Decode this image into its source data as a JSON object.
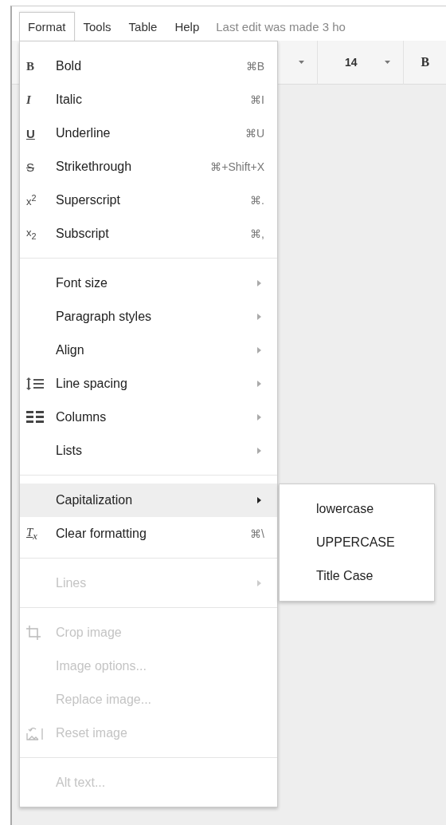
{
  "menu_bar": {
    "items": [
      {
        "label": "Format",
        "selected": true
      },
      {
        "label": "Tools",
        "selected": false
      },
      {
        "label": "Table",
        "selected": false
      },
      {
        "label": "Help",
        "selected": false
      }
    ],
    "status": "Last edit was made 3 ho"
  },
  "toolbar": {
    "items": [
      {
        "kind": "caret"
      },
      {
        "kind": "text",
        "label": "14"
      },
      {
        "kind": "caret"
      },
      {
        "kind": "bold",
        "label": "B"
      }
    ]
  },
  "format_menu": {
    "sections": [
      [
        {
          "label": "Bold",
          "shortcut": "⌘B",
          "icon": {
            "kind": "bold",
            "glyph": "B"
          },
          "has_submenu": false,
          "disabled": false,
          "selected": false
        },
        {
          "label": "Italic",
          "shortcut": "⌘I",
          "icon": {
            "kind": "italic",
            "glyph": "I"
          },
          "has_submenu": false,
          "disabled": false,
          "selected": false
        },
        {
          "label": "Underline",
          "shortcut": "⌘U",
          "icon": {
            "kind": "underline",
            "glyph": "U"
          },
          "has_submenu": false,
          "disabled": false,
          "selected": false
        },
        {
          "label": "Strikethrough",
          "shortcut": "⌘+Shift+X",
          "icon": {
            "kind": "strike",
            "glyph": "S"
          },
          "has_submenu": false,
          "disabled": false,
          "selected": false
        },
        {
          "label": "Superscript",
          "shortcut": "⌘.",
          "icon": {
            "kind": "superscript",
            "glyph": "x$^{2}$"
          },
          "has_submenu": false,
          "disabled": false,
          "selected": false
        },
        {
          "label": "Subscript",
          "shortcut": "⌘,",
          "icon": {
            "kind": "subscript",
            "glyph": "x$_{2}$"
          },
          "has_submenu": false,
          "disabled": false,
          "selected": false
        }
      ],
      [
        {
          "label": "Font size",
          "has_submenu": true,
          "disabled": false,
          "selected": false
        },
        {
          "label": "Paragraph styles",
          "has_submenu": true,
          "disabled": false,
          "selected": false
        },
        {
          "label": "Align",
          "has_submenu": true,
          "disabled": false,
          "selected": false
        },
        {
          "label": "Line spacing",
          "icon": {
            "kind": "line-spacing"
          },
          "has_submenu": true,
          "disabled": false,
          "selected": false
        },
        {
          "label": "Columns",
          "icon": {
            "kind": "columns"
          },
          "has_submenu": true,
          "disabled": false,
          "selected": false
        },
        {
          "label": "Lists",
          "has_submenu": true,
          "disabled": false,
          "selected": false
        }
      ],
      [
        {
          "label": "Capitalization",
          "has_submenu": true,
          "disabled": false,
          "selected": true,
          "submenu_items": [
            "lowercase",
            "UPPERCASE",
            "Title Case"
          ]
        },
        {
          "label": "Clear formatting",
          "shortcut": "⌘\\",
          "icon": {
            "kind": "clear",
            "glyph": "T$_{x}$"
          },
          "has_submenu": false,
          "disabled": false,
          "selected": false
        }
      ],
      [
        {
          "label": "Lines",
          "has_submenu": true,
          "disabled": true,
          "selected": false
        }
      ],
      [
        {
          "label": "Crop image",
          "icon": {
            "kind": "crop"
          },
          "has_submenu": false,
          "disabled": true,
          "selected": false
        },
        {
          "label": "Image options...",
          "has_submenu": false,
          "disabled": true,
          "selected": false
        },
        {
          "label": "Replace image...",
          "has_submenu": false,
          "disabled": true,
          "selected": false
        },
        {
          "label": "Reset image",
          "icon": {
            "kind": "reset-image"
          },
          "has_submenu": false,
          "disabled": true,
          "selected": false
        }
      ],
      [
        {
          "label": "Alt text...",
          "has_submenu": false,
          "disabled": true,
          "selected": false
        }
      ]
    ]
  }
}
